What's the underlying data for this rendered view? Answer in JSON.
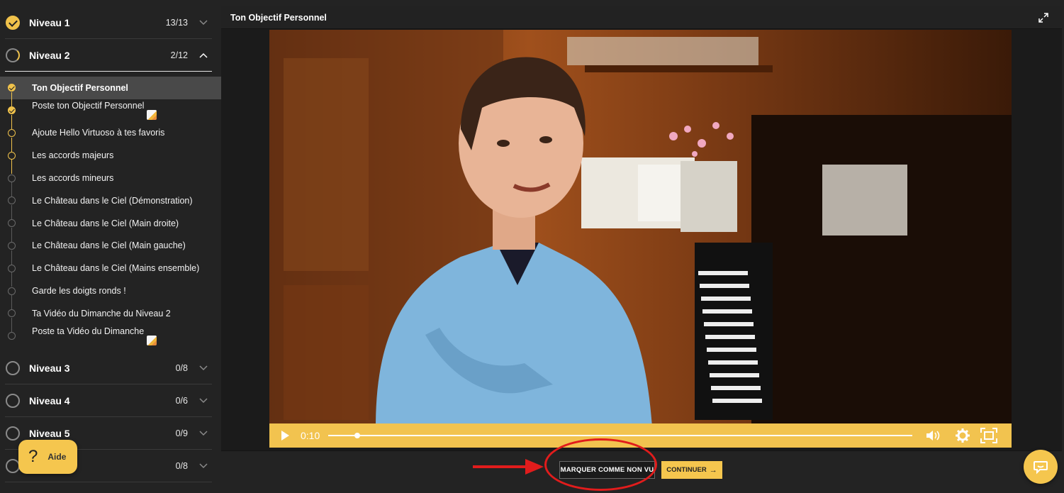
{
  "sidebar": {
    "levels": [
      {
        "title": "Niveau 1",
        "count": "13/13",
        "status": "done"
      },
      {
        "title": "Niveau 2",
        "count": "2/12",
        "status": "partial"
      },
      {
        "title": "Niveau 3",
        "count": "0/8",
        "status": "todo"
      },
      {
        "title": "Niveau 4",
        "count": "0/6",
        "status": "todo"
      },
      {
        "title": "Niveau 5",
        "count": "0/9",
        "status": "todo"
      },
      {
        "title": "",
        "count": "0/8",
        "status": "todo"
      }
    ],
    "lessons": [
      {
        "title": "Ton Objectif Personnel",
        "status": "done"
      },
      {
        "title": "Poste ton Objectif Personnel",
        "status": "done"
      },
      {
        "title": "Ajoute Hello Virtuoso à tes favoris",
        "status": "seen"
      },
      {
        "title": "Les accords majeurs",
        "status": "seen"
      },
      {
        "title": "Les accords mineurs",
        "status": "todo"
      },
      {
        "title": "Le Château dans le Ciel (Démonstration)",
        "status": "todo"
      },
      {
        "title": "Le Château dans le Ciel (Main droite)",
        "status": "todo"
      },
      {
        "title": "Le Château dans le Ciel (Main gauche)",
        "status": "todo"
      },
      {
        "title": "Le Château dans le Ciel (Mains ensemble)",
        "status": "todo"
      },
      {
        "title": "Garde les doigts ronds !",
        "status": "todo"
      },
      {
        "title": "Ta Vidéo du Dimanche du Niveau 2",
        "status": "todo"
      },
      {
        "title": "Poste ta Vidéo du Dimanche",
        "status": "todo"
      }
    ]
  },
  "help": {
    "label": "Aide",
    "icon": "question-mark-icon"
  },
  "main": {
    "title": "Ton Objectif Personnel",
    "video": {
      "current_time": "0:10",
      "progress_fraction": 0.05
    },
    "buttons": {
      "mark_unseen": "MARQUER COMME NON VU",
      "continue": "CONTINUER"
    }
  },
  "colors": {
    "accent": "#f5c64e",
    "background": "#232323",
    "annotation": "#e11c1c"
  }
}
